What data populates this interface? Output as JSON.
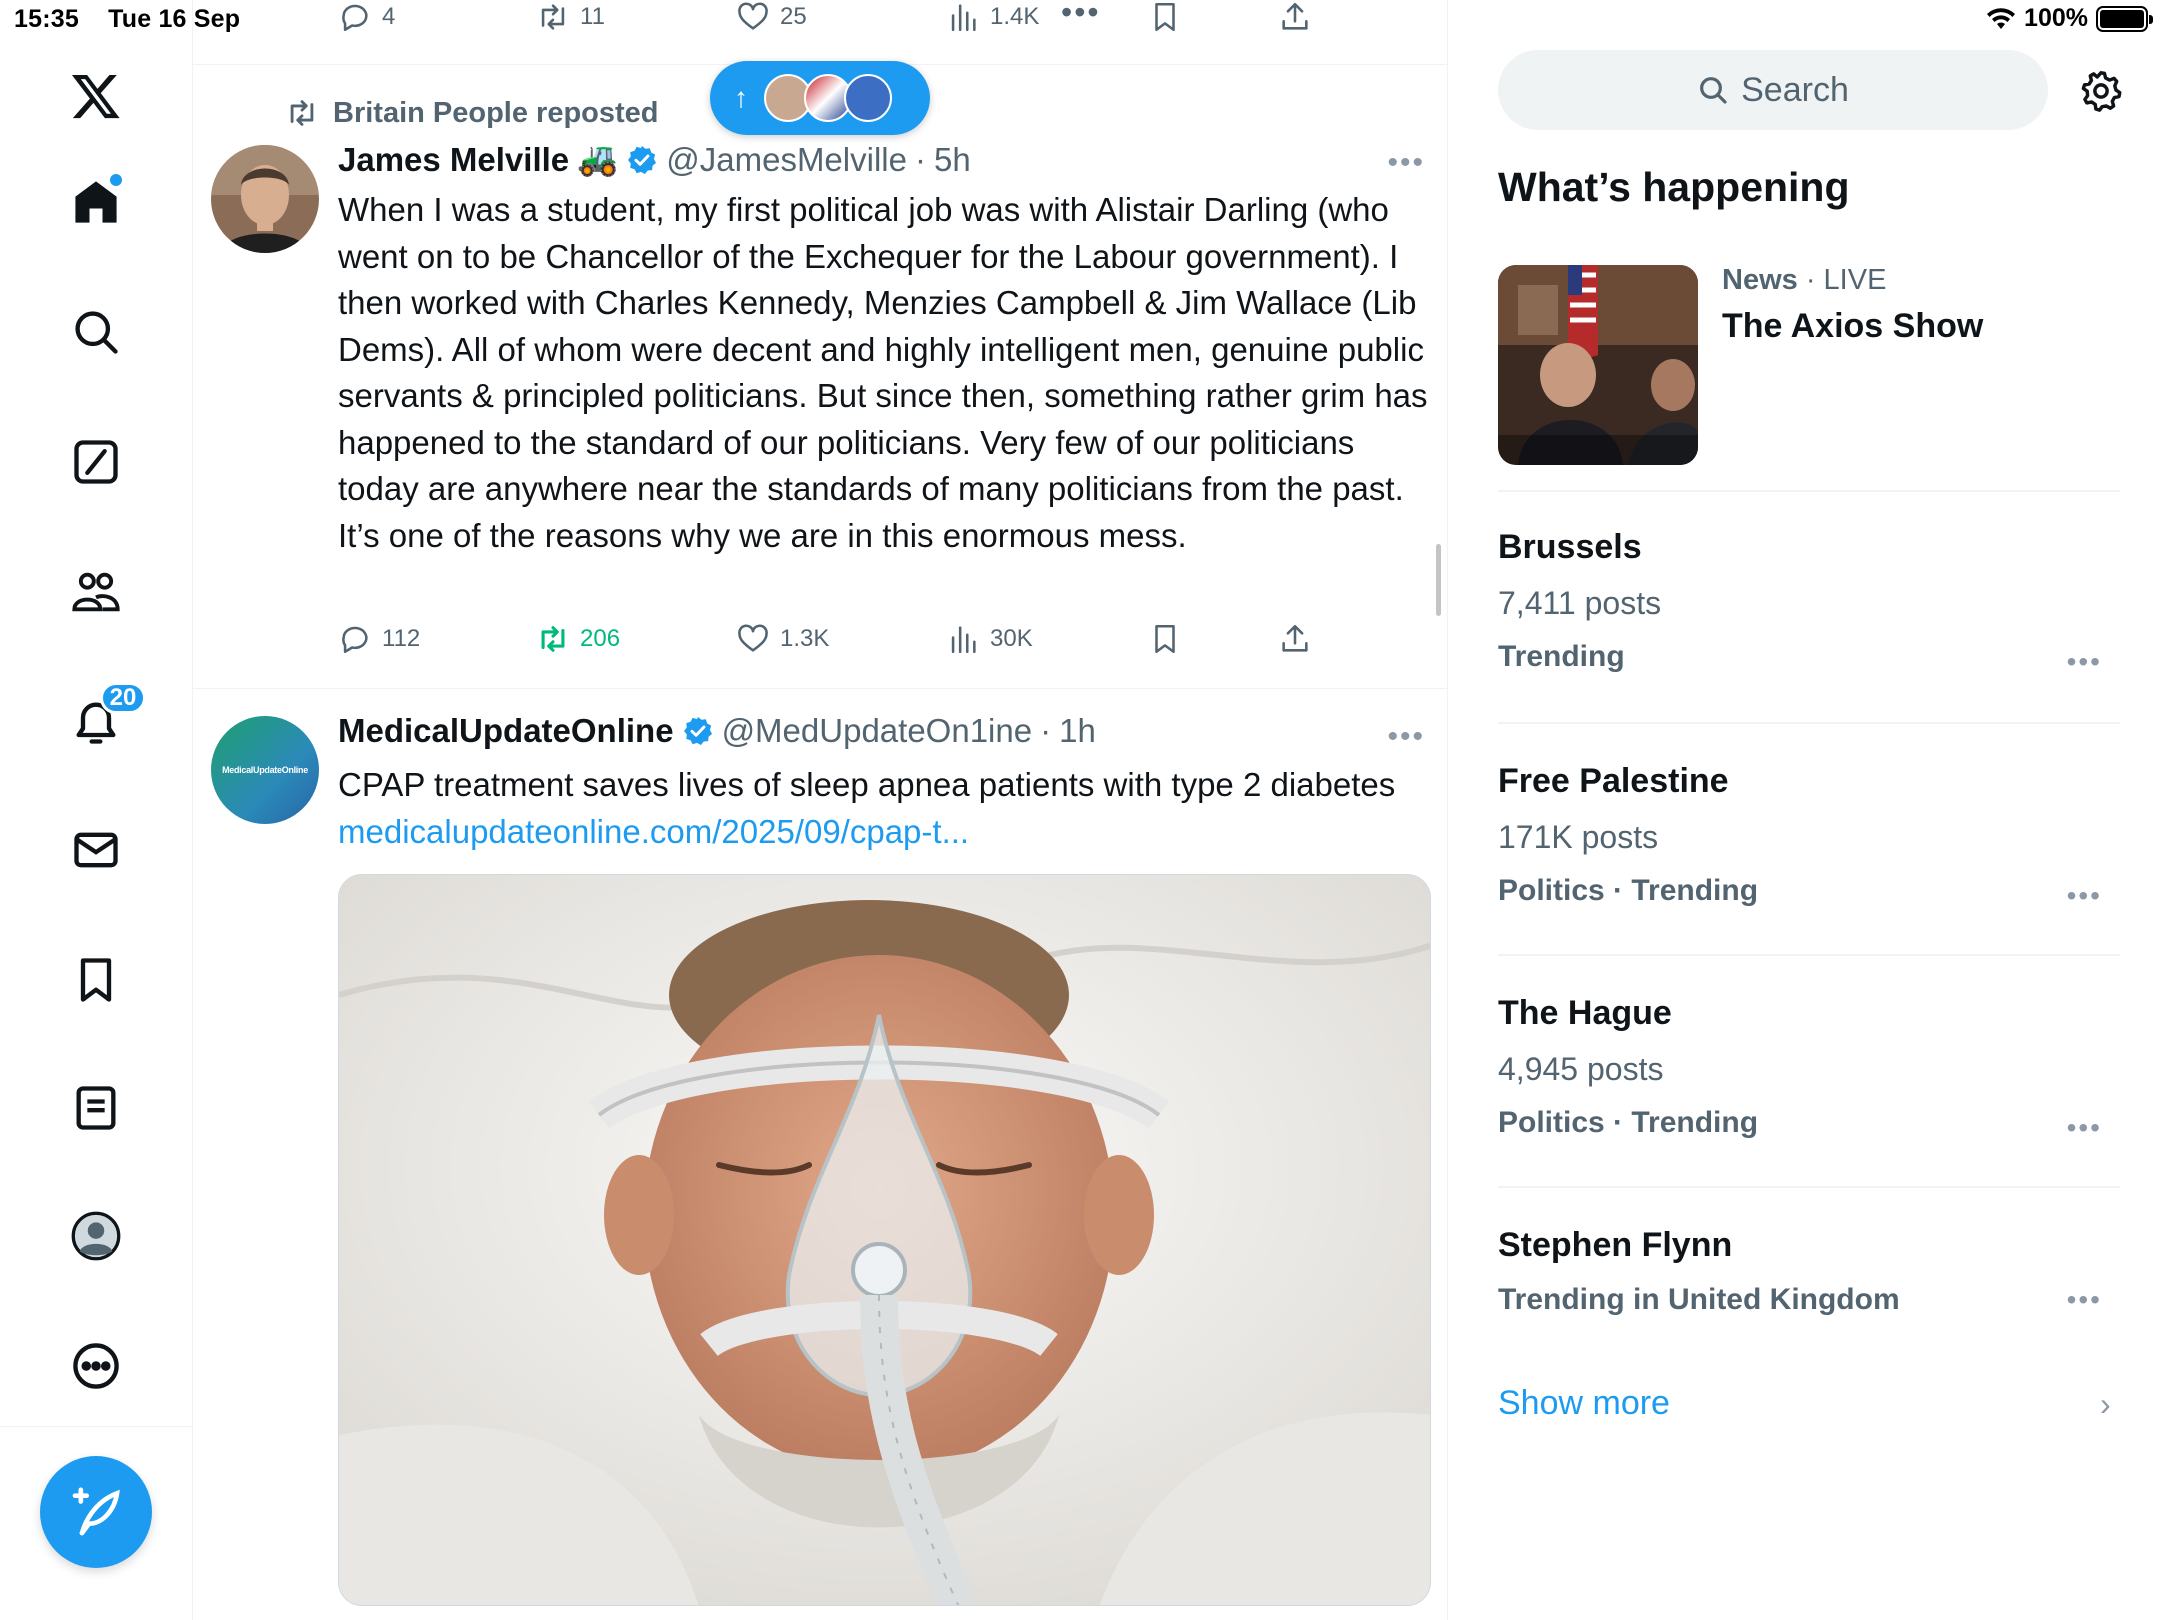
{
  "status_bar": {
    "time": "15:35",
    "date": "Tue 16 Sep",
    "battery": "100%"
  },
  "nav": {
    "notifications_badge": "20",
    "items": [
      "X logo",
      "Home",
      "Explore",
      "Grok",
      "Communities",
      "Notifications",
      "Messages",
      "Bookmarks",
      "Lists",
      "Profile",
      "More"
    ]
  },
  "prev_tweet_actions": {
    "replies": "4",
    "reposts": "11",
    "likes": "25",
    "views": "1.4K"
  },
  "tweet1": {
    "repost_label": "Britain People reposted",
    "name": "James Melville",
    "emoji": "🚜",
    "handle": "@JamesMelville",
    "separator": "·",
    "time": "5h",
    "text": "When I was a student, my first political job was with Alistair Darling (who went on to be Chancellor of the Exchequer for the Labour government). I then worked with Charles Kennedy, Menzies Campbell & Jim Wallace (Lib Dems). All of whom were decent and highly intelligent men, genuine public servants & principled politicians. But since then, something rather grim has happened to the standard of our politicians. Very few of our politicians today are anywhere near the standards of many politicians from the past. It’s one of the reasons why we are in this enormous mess.",
    "replies": "112",
    "reposts": "206",
    "likes": "1.3K",
    "views": "30K"
  },
  "tweet2": {
    "name": "MedicalUpdateOnline",
    "handle": "@MedUpdateOn1ine",
    "separator": "·",
    "time": "1h",
    "text": "CPAP treatment saves lives of sleep apnea patients with type 2 diabetes",
    "link": "medicalupdateonline.com/2025/09/cpap-t...",
    "avatar_text": "MedicalUpdateOnline"
  },
  "sidebar": {
    "search_placeholder": "Search",
    "heading": "What’s happening",
    "news": {
      "source": "News",
      "separator": " · ",
      "status": "LIVE",
      "title": "The Axios Show"
    },
    "trends": [
      {
        "title": "Brussels",
        "posts": "7,411 posts",
        "category": "Trending"
      },
      {
        "title": "Free Palestine",
        "posts": "171K posts",
        "category": "Politics · Trending"
      },
      {
        "title": "The Hague",
        "posts": "4,945 posts",
        "category": "Politics · Trending"
      },
      {
        "title": "Stephen Flynn",
        "posts": "",
        "category": "Trending in United Kingdom"
      }
    ],
    "show_more": "Show more"
  },
  "colors": {
    "accent": "#1d9bf0",
    "repost_green": "#00ba7c",
    "text": "#0f1419",
    "secondary": "#536471"
  }
}
